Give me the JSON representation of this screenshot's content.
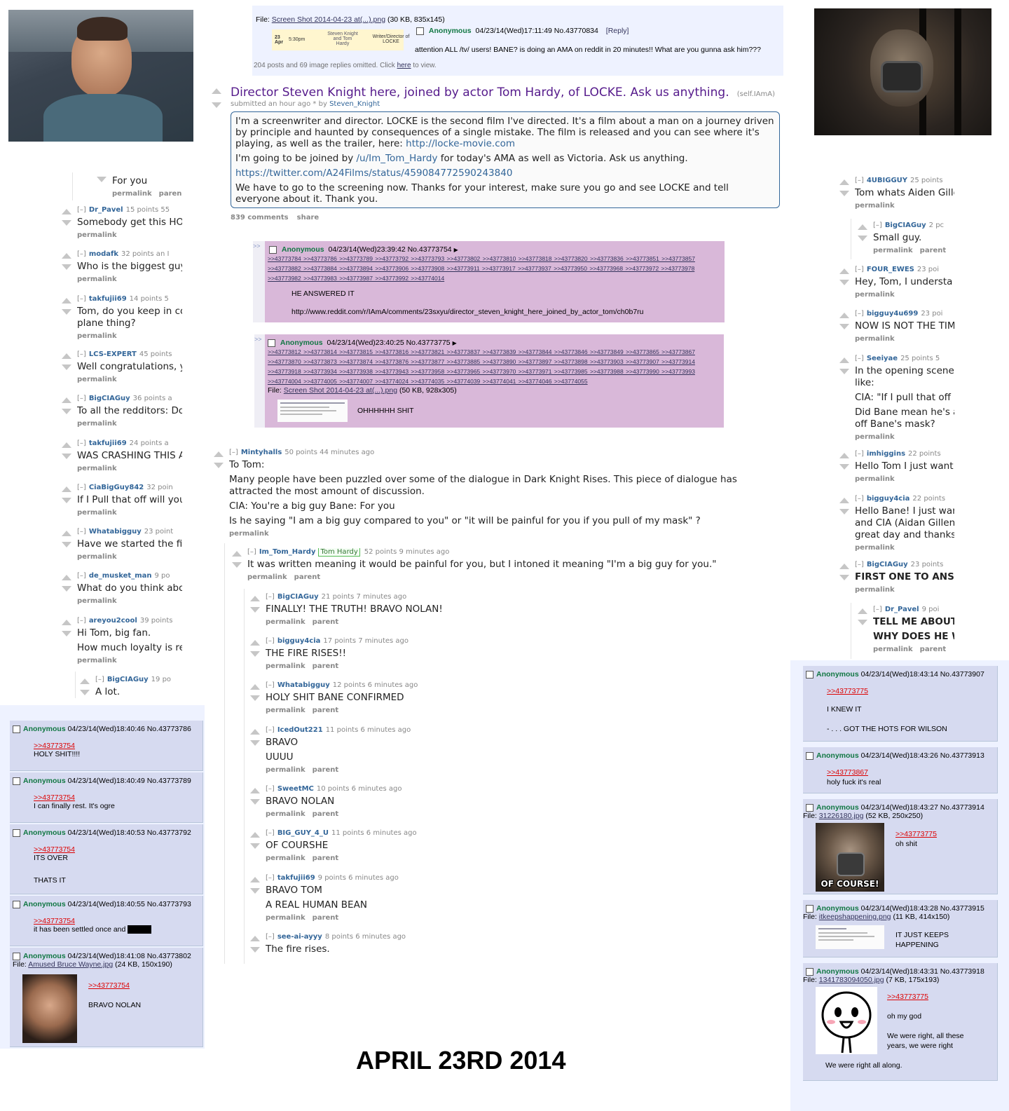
{
  "footer": {
    "date": "APRIL 23RD 2014"
  },
  "colors": {
    "reddit_link": "#369",
    "chan_name": "#117743",
    "chan_bg": "#d6daf0",
    "chan_pink": "#d9b8d9",
    "quote": "#dd0000"
  },
  "op": {
    "file_label": "File:",
    "file_link": "Screen Shot 2014-04-23 at(...).png",
    "file_meta": "(30 KB, 835x145)",
    "thumb": {
      "date": "23 Apr",
      "time": "5:30pm",
      "who": "Steven Knight and Tom Hardy",
      "role": "Writer/Director of LOCKE"
    },
    "name": "Anonymous",
    "date": "04/23/14(Wed)17:11:49 No.43770834",
    "reply": "[Reply]",
    "text": "attention ALL /tv/ users! BANE? is doing an AMA on reddit in 20 minutes!! What are you gunna ask him???",
    "omitted_pre": "204 posts and 69 image replies omitted. Click ",
    "omitted_link": "here",
    "omitted_post": " to view."
  },
  "ama": {
    "title": "Director Steven Knight here, joined by actor Tom Hardy, of LOCKE. Ask us anything.",
    "domain": "(self.IAmA)",
    "submitted": "submitted an hour ago * by ",
    "author": "Steven_Knight",
    "p1": "I'm a screenwriter and director. LOCKE is the second film I've directed. It's a film about a man on a journey driven by principle and haunted by consequences of a single mistake. The film is released and you can see where it's playing, as well as the trailer, here: ",
    "p1_link": "http://locke-movie.com",
    "p2a": "I'm going to be joined by ",
    "p2_link": "/u/Im_Tom_Hardy",
    "p2b": " for today's AMA as well as Victoria. Ask us anything.",
    "p3_link": "https://twitter.com/A24Films/status/459084772590243840",
    "p4": "We have to go to the screening now. Thanks for your interest, make sure you go and see LOCKE and tell everyone about it. Thank you.",
    "comments": "839 comments",
    "share": "share"
  },
  "pink1": {
    "name": "Anonymous",
    "date": "04/23/14(Wed)23:39:42 No.43773754",
    "replies": ">>43773784 >>43773786 >>43773789 >>43773792 >>43773793 >>43773802 >>43773810 >>43773818 >>43773820 >>43773836 >>43773851 >>43773857 >>43773882 >>43773884 >>43773894 >>43773906 >>43773908 >>43773911 >>43773917 >>43773937 >>43773950 >>43773968 >>43773972 >>43773978 >>43773982 >>43773983 >>43773987 >>43773992 >>43774014",
    "text": "HE ANSWERED IT",
    "url": "http://www.reddit.com/r/IAmA/comments/23sxyu/director_steven_knight_here_joined_by_actor_tom/ch0b7ru"
  },
  "pink2": {
    "name": "Anonymous",
    "date": "04/23/14(Wed)23:40:25 No.43773775",
    "replies": ">>43773812 >>43773814 >>43773815 >>43773816 >>43773821 >>43773837 >>43773839 >>43773844 >>43773846 >>43773849 >>43773865 >>43773867 >>43773870 >>43773873 >>43773874 >>43773876 >>43773877 >>43773885 >>43773890 >>43773897 >>43773898 >>43773903 >>43773907 >>43773914 >>43773918 >>43773934 >>43773938 >>43773943 >>43773958 >>43773965 >>43773970 >>43773971 >>43773985 >>43773988 >>43773990 >>43773993 >>43774004 >>43774005 >>43774007 >>43774024 >>43774035 >>43774039 >>43774041 >>43774046 >>43774055",
    "file_label": "File:",
    "file_link": "Screen Shot 2014-04-23 at(...).png",
    "file_meta": "(50 KB, 928x305)",
    "text": "OHHHHHH SHIT"
  },
  "mid": {
    "mintyhalls": {
      "user": "Mintyhalls",
      "meta": "50 points 44 minutes ago",
      "l1": "To Tom:",
      "l2": "Many people have been puzzled over some of the dialogue in Dark Knight Rises. This piece of dialogue has attracted the most amount of discussion.",
      "l3": "CIA: You're a big guy Bane: For you",
      "l4": "Is he saying \"I am a big guy compared to you\" or \"it will be painful for you if you pull of my mask\" ?",
      "link": "permalink"
    },
    "hardy": {
      "user": "Im_Tom_Hardy",
      "flair": "Tom Hardy",
      "meta": "52 points 9 minutes ago",
      "text": "It was written meaning it would be painful for you, but I intoned it meaning \"I'm a big guy for you.\"",
      "l1": "permalink",
      "l2": "parent"
    },
    "replies": [
      {
        "user": "BigCIAGuy",
        "meta": "21 points 7 minutes ago",
        "t1": "FINALLY! THE TRUTH! BRAVO NOLAN!",
        "t2": "",
        "l1": "permalink",
        "l2": "parent"
      },
      {
        "user": "bigguy4cia",
        "meta": "17 points 7 minutes ago",
        "t1": "THE FIRE RISES!!",
        "t2": "",
        "l1": "permalink",
        "l2": "parent"
      },
      {
        "user": "Whatabigguy",
        "meta": "12 points 6 minutes ago",
        "t1": "HOLY SHIT BANE CONFIRMED",
        "t2": "",
        "l1": "permalink",
        "l2": "parent"
      },
      {
        "user": "IcedOut221",
        "meta": "11 points 6 minutes ago",
        "t1": "BRAVO",
        "t2": "UUUU",
        "l1": "permalink",
        "l2": "parent"
      },
      {
        "user": "SweetMC",
        "meta": "10 points 6 minutes ago",
        "t1": "BRAVO NOLAN",
        "t2": "",
        "l1": "permalink",
        "l2": "parent"
      },
      {
        "user": "BIG_GUY_4_U",
        "meta": "11 points 6 minutes ago",
        "t1": "OF COURSHE",
        "t2": "",
        "l1": "permalink",
        "l2": "parent"
      },
      {
        "user": "takfujii69",
        "meta": "9 points 6 minutes ago",
        "t1": "BRAVO TOM",
        "t2": "A REAL HUMAN BEAN",
        "l1": "permalink",
        "l2": "parent"
      },
      {
        "user": "see-ai-ayyy",
        "meta": "8 points 6 minutes ago",
        "t1": "The fire rises.",
        "t2": "",
        "l1": "",
        "l2": ""
      }
    ]
  },
  "left": {
    "foryou": {
      "text": "For you",
      "l1": "permalink",
      "l2": "paren"
    },
    "comments": [
      {
        "user": "Dr_Pavel",
        "meta": "15 points 55",
        "t1": "Somebody get this HOT",
        "t2": "",
        "l1": "permalink"
      },
      {
        "user": "modafk",
        "meta": "32 points an I",
        "t1": "Who is the biggest guy",
        "t2": "",
        "l1": "permalink"
      },
      {
        "user": "takfujii69",
        "meta": "14 points 5",
        "t1": "Tom, do you keep in co",
        "t2": "plane thing?",
        "l1": "permalink"
      },
      {
        "user": "LCS-EXPERT",
        "meta": "45 points",
        "t1": "Well congratulations, y",
        "t2": "",
        "l1": "permalink"
      },
      {
        "user": "BigCIAGuy",
        "meta": "36 points a",
        "t1": "To all the redditors: Do",
        "t2": "",
        "l1": "permalink"
      },
      {
        "user": "takfujii69",
        "meta": "24 points a",
        "t1": "WAS CRASHING THIS A",
        "t2": "",
        "l1": "permalink"
      },
      {
        "user": "CiaBigGuy842",
        "meta": "32 poin",
        "t1": "If I Pull that off will you",
        "t2": "",
        "l1": "permalink"
      },
      {
        "user": "Whatabigguy",
        "meta": "23 point",
        "t1": "Have we started the fi",
        "t2": "",
        "l1": "permalink"
      },
      {
        "user": "de_musket_man",
        "meta": "9 po",
        "t1": "What do you think abo",
        "t2": "",
        "l1": "permalink"
      },
      {
        "user": "areyou2cool",
        "meta": "39 points",
        "t1": "Hi Tom, big fan.",
        "t2": "How much loyalty is re",
        "l1": "permalink"
      }
    ],
    "alot": {
      "user": "BigCIAGuy",
      "meta": "19 po",
      "text": "A lot."
    },
    "chan": [
      {
        "name": "Anonymous",
        "date": "04/23/14(Wed)18:40:46 No.43773786",
        "quote": ">>43773754",
        "t1": "HOLY SHIT!!!!",
        "t2": ""
      },
      {
        "name": "Anonymous",
        "date": "04/23/14(Wed)18:40:49 No.43773789",
        "quote": ">>43773754",
        "t1": "I can finally rest. It's ogre",
        "t2": ""
      },
      {
        "name": "Anonymous",
        "date": "04/23/14(Wed)18:40:53 No.43773792",
        "quote": ">>43773754",
        "t1": "ITS OVER",
        "t2": "THATS IT"
      },
      {
        "name": "Anonymous",
        "date": "04/23/14(Wed)18:40:55 No.43773793",
        "quote": ">>43773754",
        "t1": "it has been settled once and",
        "t2": ""
      },
      {
        "name": "Anonymous",
        "date": "04/23/14(Wed)18:41:08 No.43773802",
        "file_label": "File:",
        "file_link": "Amused Bruce Wayne.jpg",
        "file_meta": "(24 KB, 150x190)",
        "quote": ">>43773754",
        "t1": "BRAVO NOLAN",
        "t2": ""
      }
    ]
  },
  "right": {
    "comments": [
      {
        "user": "4UBIGGUY",
        "meta": "25 points",
        "t1": "Tom whats Aiden Gille",
        "t2": "",
        "t3": "",
        "t4": "",
        "l1": "permalink",
        "l2": ""
      },
      {
        "user": "BigCIAGuy",
        "meta": "2 pc",
        "t1": "Small guy.",
        "t2": "",
        "t3": "",
        "t4": "",
        "l1": "permalink",
        "l2": "parent"
      },
      {
        "user": "FOUR_EWES",
        "meta": "23 poi",
        "t1": "Hey, Tom, I understa",
        "t2": "",
        "t3": "",
        "t4": "",
        "l1": "permalink",
        "l2": ""
      },
      {
        "user": "bigguy4u699",
        "meta": "23 poi",
        "t1": "NOW IS NOT THE TIM",
        "t2": "",
        "t3": "",
        "t4": "",
        "l1": "permalink",
        "l2": ""
      },
      {
        "user": "Seeiyae",
        "meta": "25 points 5",
        "t1": "In the opening scene",
        "t2": "like:",
        "t3": "CIA: \"If I pull that off",
        "t4": "Did Bane mean he's a",
        "t5": "off Bane's mask?",
        "l1": "permalink",
        "l2": ""
      },
      {
        "user": "imhiggins",
        "meta": "22 points",
        "t1": "Hello Tom I just want",
        "t2": "",
        "t3": "",
        "t4": "",
        "l1": "permalink",
        "l2": ""
      },
      {
        "user": "bigguy4cia",
        "meta": "22 points",
        "t1": "Hello Bane! I just wan",
        "t2": "and CIA (Aidan Gillen)",
        "t3": "great day and thanks",
        "t4": "",
        "l1": "permalink",
        "l2": ""
      },
      {
        "user": "BigCIAGuy",
        "meta": "23 points",
        "t1": "FIRST ONE TO ANSW",
        "t2": "",
        "t3": "",
        "t4": "",
        "l1": "permalink",
        "l2": ""
      },
      {
        "user": "Dr_Pavel",
        "meta": "9 poi",
        "t1": "TELL ME ABOUT",
        "t2": "WHY DOES HE W",
        "t3": "",
        "t4": "",
        "l1": "permalink",
        "l2": "parent"
      }
    ],
    "chan": [
      {
        "name": "Anonymous",
        "date": "04/23/14(Wed)18:43:14 No.43773907",
        "quote": ">>43773775",
        "t1": "I KNEW IT",
        "t2": "- . . . GOT THE HOTS FOR WILSON",
        "t3": "",
        "t4": ""
      },
      {
        "name": "Anonymous",
        "date": "04/23/14(Wed)18:43:26 No.43773913",
        "quote": ">>43773867",
        "t1": "holy fuck it's real",
        "t2": "",
        "t3": "",
        "t4": ""
      },
      {
        "name": "Anonymous",
        "date": "04/23/14(Wed)18:43:27 No.43773914",
        "file_label": "File:",
        "file_link": "31226180.jpg",
        "file_meta": "(52 KB, 250x250)",
        "quote": ">>43773775",
        "t1": "oh shit",
        "t2": "",
        "img_text": "OF COURSE!",
        "t3": "",
        "t4": ""
      },
      {
        "name": "Anonymous",
        "date": "04/23/14(Wed)18:43:28 No.43773915",
        "file_label": "File:",
        "file_link": "itkeepshappening.png",
        "file_meta": "(11 KB, 414x150)",
        "quote": "",
        "t1": "IT JUST KEEPS",
        "t2": "HAPPENING",
        "t3": "",
        "t4": ""
      },
      {
        "name": "Anonymous",
        "date": "04/23/14(Wed)18:43:31 No.43773918",
        "file_label": "File:",
        "file_link": "1341783094050.jpg",
        "file_meta": "(7 KB, 175x193)",
        "quote": ">>43773775",
        "t1": "oh my god",
        "t2": "We were right, all these",
        "t3": "years, we were right",
        "t4": "We were right all along."
      }
    ]
  }
}
